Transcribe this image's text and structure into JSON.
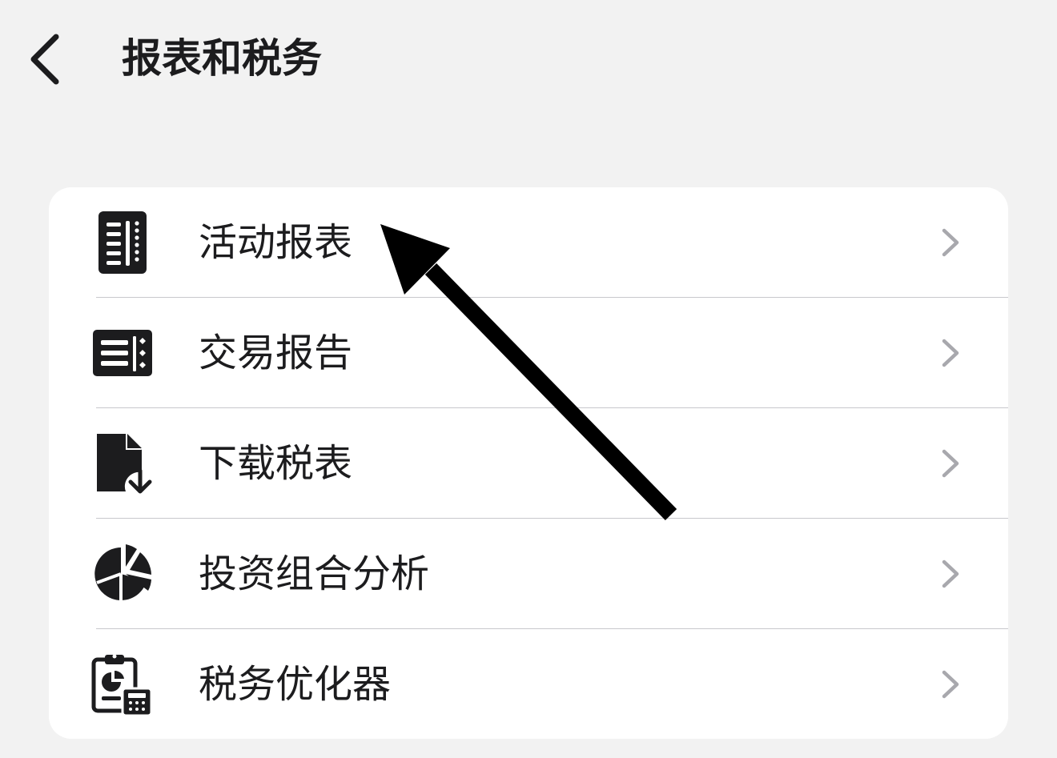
{
  "header": {
    "title": "报表和税务",
    "back_icon": "chevron-left-icon"
  },
  "menu": {
    "items": [
      {
        "label": "活动报表",
        "icon": "activity-report-icon"
      },
      {
        "label": "交易报告",
        "icon": "trade-report-icon"
      },
      {
        "label": "下载税表",
        "icon": "download-tax-form-icon"
      },
      {
        "label": "投资组合分析",
        "icon": "pie-chart-icon"
      },
      {
        "label": "税务优化器",
        "icon": "tax-optimizer-icon"
      }
    ],
    "chevron_icon": "chevron-right-icon"
  },
  "annotation": {
    "icon": "pointer-arrow-icon",
    "color": "#000000"
  },
  "colors": {
    "background": "#f2f2f2",
    "card": "#ffffff",
    "text": "#1c1c1e",
    "chevron": "#a8a8ad",
    "divider": "#c8c8cc"
  }
}
